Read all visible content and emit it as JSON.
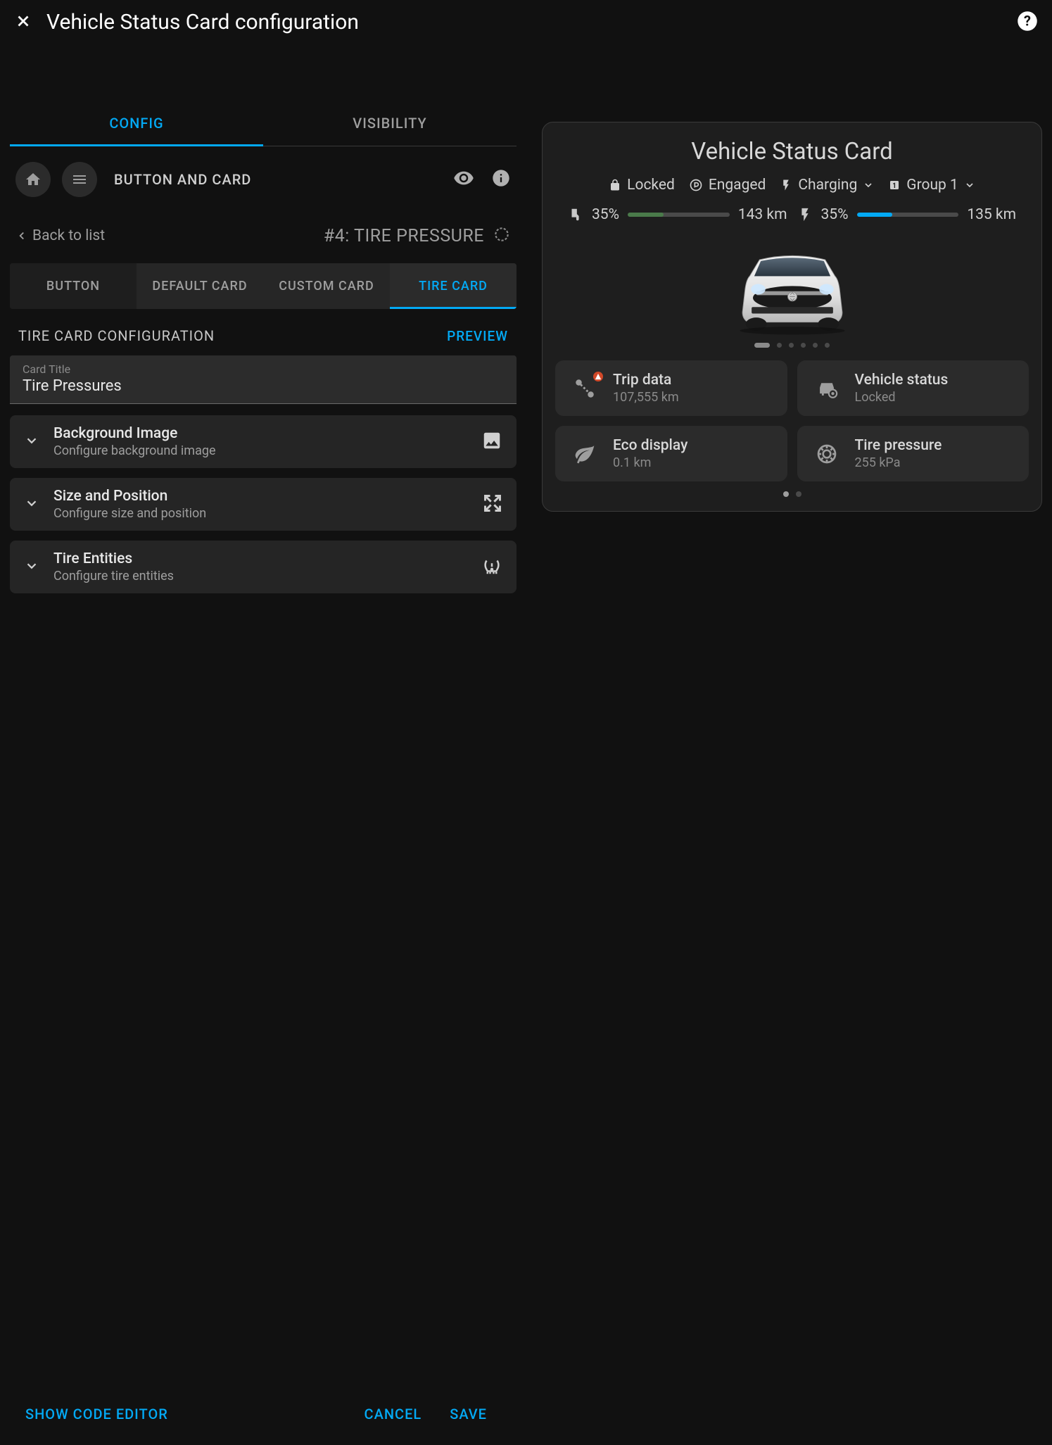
{
  "header": {
    "title": "Vehicle Status Card configuration"
  },
  "mainTabs": {
    "config": "CONFIG",
    "visibility": "VISIBILITY"
  },
  "toolbar": {
    "label": "BUTTON AND CARD"
  },
  "breadcrumb": {
    "back": "Back to list",
    "title": "#4: TIRE PRESSURE"
  },
  "subTabs": {
    "button": "BUTTON",
    "defaultCard": "DEFAULT CARD",
    "customCard": "CUSTOM CARD",
    "tireCard": "TIRE CARD"
  },
  "section": {
    "title": "TIRE CARD CONFIGURATION",
    "preview": "PREVIEW"
  },
  "cardTitleField": {
    "label": "Card Title",
    "value": "Tire Pressures"
  },
  "rows": {
    "bg": {
      "title": "Background Image",
      "sub": "Configure background image"
    },
    "size": {
      "title": "Size and Position",
      "sub": "Configure size and position"
    },
    "tire": {
      "title": "Tire Entities",
      "sub": "Configure tire entities"
    }
  },
  "footer": {
    "showCode": "SHOW CODE EDITOR",
    "cancel": "CANCEL",
    "save": "SAVE"
  },
  "preview": {
    "title": "Vehicle Status Card",
    "status": {
      "locked": "Locked",
      "engaged": "Engaged",
      "charging": "Charging",
      "group": "Group 1"
    },
    "range1": {
      "pct": "35%",
      "dist": "143 km",
      "fill": 35
    },
    "range2": {
      "pct": "35%",
      "dist": "135 km",
      "fill": 35
    },
    "tiles": {
      "trip": {
        "title": "Trip data",
        "sub": "107,555 km"
      },
      "vehicle": {
        "title": "Vehicle status",
        "sub": "Locked"
      },
      "eco": {
        "title": "Eco display",
        "sub": "0.1 km"
      },
      "tire": {
        "title": "Tire pressure",
        "sub": "255 kPa"
      }
    }
  }
}
